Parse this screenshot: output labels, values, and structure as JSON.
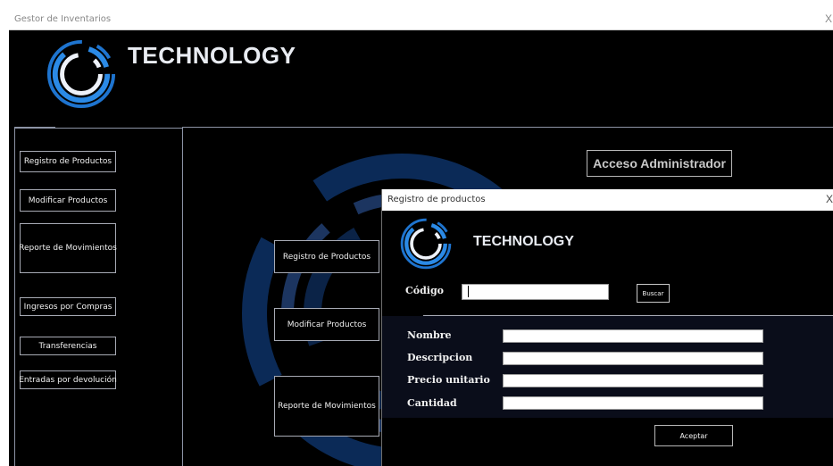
{
  "main_window": {
    "title": "Gestor de Inventarios",
    "close_glyph": "X",
    "brand": "TECHNOLOGY",
    "logo_icon": "ring-logo-icon",
    "sidebar": {
      "items": [
        {
          "label": "Registro de Productos"
        },
        {
          "label": "Modificar Productos"
        },
        {
          "label": "Reporte de Movimientos"
        },
        {
          "label": "Ingresos por Compras"
        },
        {
          "label": "Transferencias"
        },
        {
          "label": "Entradas por devolución"
        }
      ]
    },
    "center_buttons": [
      {
        "label": "Registro de Productos"
      },
      {
        "label": "Modificar Productos"
      },
      {
        "label": "Reporte de Movimientos"
      }
    ],
    "admin_button": "Acceso Administrador"
  },
  "dialog": {
    "title": "Registro de productos",
    "close_glyph": "X",
    "brand": "TECHNOLOGY",
    "logo_icon": "ring-logo-icon",
    "codigo": {
      "label": "Código",
      "value": ""
    },
    "buscar_label": "Buscar",
    "fields": [
      {
        "label": "Nombre",
        "value": ""
      },
      {
        "label": "Descripcion",
        "value": ""
      },
      {
        "label": "Precio unitario",
        "value": ""
      },
      {
        "label": "Cantidad",
        "value": ""
      }
    ],
    "aceptar_label": "Aceptar"
  },
  "colors": {
    "background": "#000000",
    "accent_blue": "#1b63b8",
    "border_gray": "#a7aab4"
  }
}
